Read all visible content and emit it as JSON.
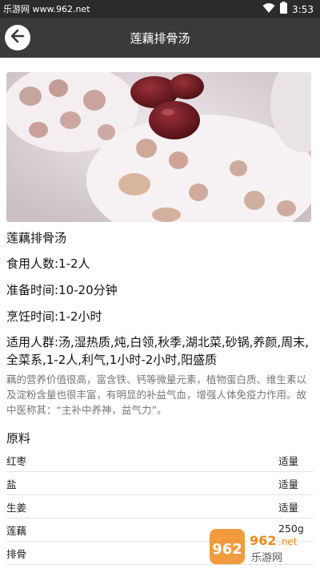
{
  "status": {
    "watermark": "乐游网 www.962.net",
    "time": "3:53"
  },
  "header": {
    "title": "莲藕排骨汤"
  },
  "recipe": {
    "name": "莲藕排骨汤",
    "servings": "食用人数:1-2人",
    "prep_time": "准备时间:10-20分钟",
    "cook_time": "烹饪时间:1-2小时",
    "suitable": "适用人群:汤,湿热质,炖,白领,秋季,湖北菜,砂锅,养颜,周末,全菜系,1-2人,利气,1小时-2小时,阳盛质",
    "description": "藕的营养价值很高，富含铁、钙等微量元素，植物蛋白质、维生素以及淀粉含量也很丰富，有明显的补益气血，增强人体免疫力作用。故中医称其：“主补中养神，益气力”。"
  },
  "ingredients": {
    "title": "原料",
    "items": [
      {
        "name": "红枣",
        "amount": "适量"
      },
      {
        "name": "盐",
        "amount": "适量"
      },
      {
        "name": "生姜",
        "amount": "适量"
      },
      {
        "name": "莲藕",
        "amount": "250g"
      },
      {
        "name": "排骨",
        "amount": ""
      }
    ]
  },
  "watermark_logo": {
    "number": "962",
    "suffix": ".net",
    "cn": "乐游网"
  },
  "colors": {
    "status_bar": "#2b2b2b",
    "app_bar": "#3a3a3a",
    "logo_orange": "#f08a1c"
  }
}
